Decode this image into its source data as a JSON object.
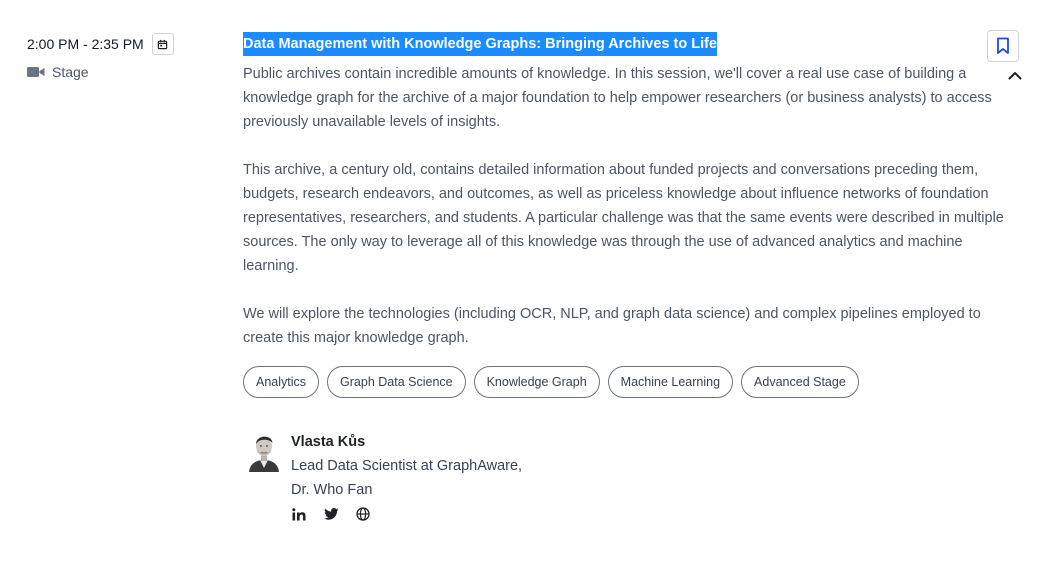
{
  "session": {
    "time": "2:00 PM - 2:35 PM",
    "venue": "Stage",
    "title": "Data Management with Knowledge Graphs: Bringing Archives to Life",
    "description": [
      "Public archives contain incredible amounts of knowledge. In this session, we'll cover a real use case of building a knowledge graph for the archive of a major foundation to help empower researchers (or business analysts) to access previously unavailable levels of insights.",
      "This archive, a century old, contains detailed information about funded projects and conversations preceding them, budgets, research endeavors, and outcomes, as well as priceless knowledge about influence networks of foundation representatives, researchers, and students. A particular challenge was that the same events were described in multiple sources. The only way to leverage all of this knowledge was through the use of advanced analytics and machine learning.",
      "We will explore the technologies (including OCR, NLP, and graph data science) and complex pipelines employed to create this major knowledge graph."
    ],
    "tags": [
      "Analytics",
      "Graph Data Science",
      "Knowledge Graph",
      "Machine Learning",
      "Advanced Stage"
    ]
  },
  "speaker": {
    "name": "Vlasta Kůs",
    "role_line1": "Lead Data Scientist at GraphAware,",
    "role_line2": "Dr. Who Fan"
  },
  "icons": {
    "calendar": "calendar-icon",
    "venue": "video-camera-icon",
    "bookmark": "bookmark-icon",
    "collapse": "chevron-up-icon",
    "linkedin": "linkedin-icon",
    "twitter": "twitter-icon",
    "website": "globe-icon"
  },
  "colors": {
    "title_highlight": "#1a8cff",
    "bookmark_accent": "#1d4ed8",
    "body_text": "#4b5563"
  }
}
